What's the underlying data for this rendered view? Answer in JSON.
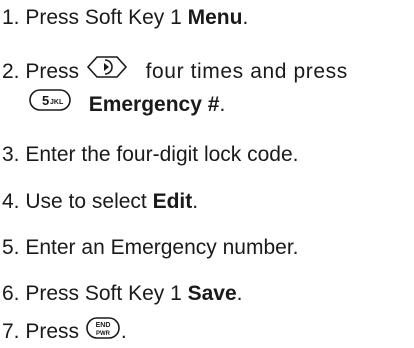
{
  "steps": [
    {
      "number": "1.",
      "text": "Press Soft Key 1",
      "bold": "Menu",
      "tail": "."
    },
    {
      "number": "2.",
      "text_before": "Press",
      "icon1": "nav-right-key-icon",
      "text_after": "four times and press",
      "icon2": "key-5-jkl-icon",
      "key5_label": "5",
      "key5_sub": "JKL",
      "bold": "Emergency #",
      "tail": "."
    },
    {
      "number": "3.",
      "text": "Enter the four-digit lock code."
    },
    {
      "number": "4.",
      "text": "Use to select",
      "bold": "Edit",
      "tail": "."
    },
    {
      "number": "5.",
      "text": "Enter an Emergency number."
    },
    {
      "number": "6.",
      "text": "Press Soft Key 1",
      "bold": "Save",
      "tail": "."
    },
    {
      "number": "7.",
      "text": "Press",
      "icon": "end-pwr-key-icon",
      "end_label": "END",
      "pwr_label": "PWR",
      "tail": "."
    }
  ]
}
